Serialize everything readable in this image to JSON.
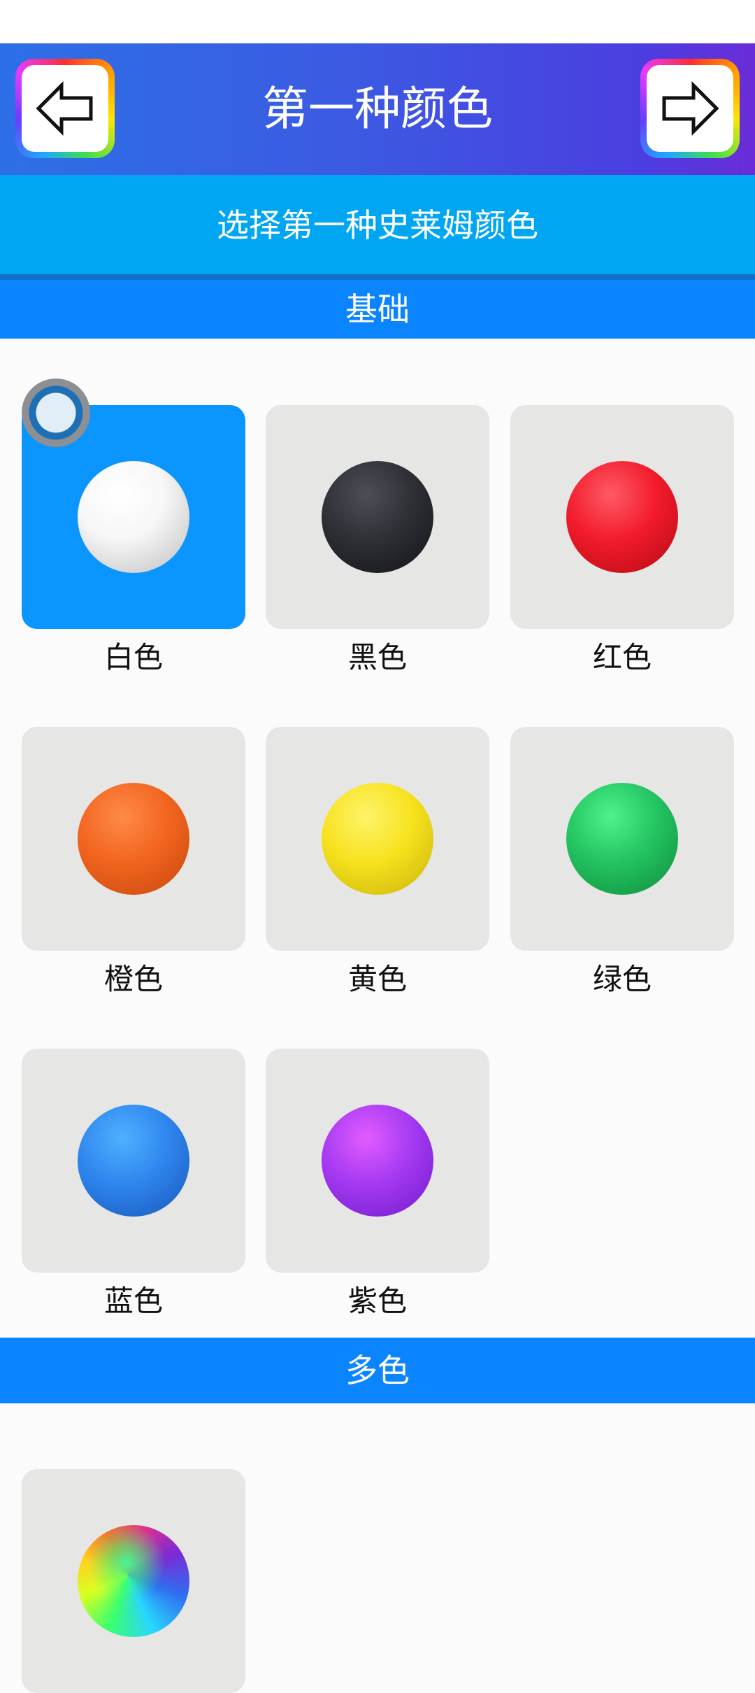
{
  "header": {
    "title": "第一种颜色",
    "back_icon": "arrow-left-icon",
    "next_icon": "arrow-right-icon"
  },
  "subtitle": "选择第一种史莱姆颜色",
  "sections": {
    "basic": {
      "title": "基础",
      "items": [
        {
          "label": "白色",
          "color": "#f5f5f5",
          "selected": true
        },
        {
          "label": "黑色",
          "color": "#2a2c31"
        },
        {
          "label": "红色",
          "color": "#ee1c2b"
        },
        {
          "label": "橙色",
          "color": "#f0651f"
        },
        {
          "label": "黄色",
          "color": "#f2dd1c"
        },
        {
          "label": "绿色",
          "color": "#22c05f"
        },
        {
          "label": "蓝色",
          "color": "#2e84ec"
        },
        {
          "label": "紫色",
          "color": "#a03af0"
        }
      ]
    },
    "multi": {
      "title": "多色",
      "items": [
        {
          "label": "",
          "color": "rainbow"
        }
      ]
    }
  },
  "colors": {
    "header_start": "#2d6fe6",
    "header_end": "#6a2cd8",
    "subtitle_bg": "#00a6f2",
    "section_bg": "#0a84ff",
    "selected_card": "#0a95ff",
    "card_bg": "#e6e6e4"
  }
}
